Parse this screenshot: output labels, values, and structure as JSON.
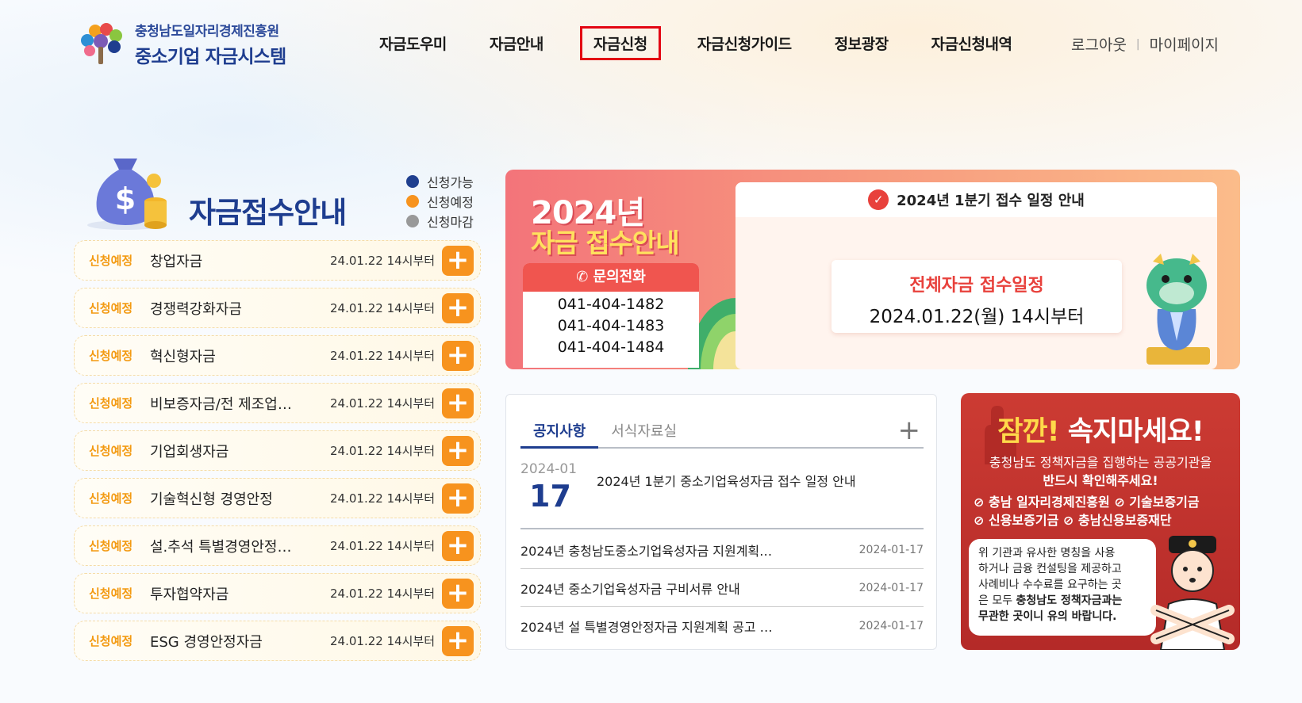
{
  "header": {
    "logo_sub": "충청남도일자리경제진흥원",
    "logo_main": "중소기업 자금시스템",
    "nav": [
      "자금도우미",
      "자금안내",
      "자금신청",
      "자금신청가이드",
      "정보광장",
      "자금신청내역"
    ],
    "active_nav": "자금신청",
    "logout": "로그아웃",
    "mypage": "마이페이지"
  },
  "fund_section": {
    "title": "자금접수안내",
    "legend": [
      {
        "label": "신청가능",
        "color": "#1f3f8f"
      },
      {
        "label": "신청예정",
        "color": "#f7931e"
      },
      {
        "label": "신청마감",
        "color": "#999999"
      }
    ],
    "items": [
      {
        "status": "신청예정",
        "name": "창업자금",
        "date": "24.01.22 14시부터"
      },
      {
        "status": "신청예정",
        "name": "경쟁력강화자금",
        "date": "24.01.22 14시부터"
      },
      {
        "status": "신청예정",
        "name": "혁신형자금",
        "date": "24.01.22 14시부터"
      },
      {
        "status": "신청예정",
        "name": "비보증자금/전 제조업…",
        "date": "24.01.22 14시부터"
      },
      {
        "status": "신청예정",
        "name": "기업회생자금",
        "date": "24.01.22 14시부터"
      },
      {
        "status": "신청예정",
        "name": "기술혁신형 경영안정",
        "date": "24.01.22 14시부터"
      },
      {
        "status": "신청예정",
        "name": "설.추석 특별경영안정…",
        "date": "24.01.22 14시부터"
      },
      {
        "status": "신청예정",
        "name": "투자협약자금",
        "date": "24.01.22 14시부터"
      },
      {
        "status": "신청예정",
        "name": "ESG 경영안정자금",
        "date": "24.01.22 14시부터"
      }
    ]
  },
  "banner": {
    "year": "2024년",
    "subtitle": "자금 접수안내",
    "contact_label": "문의전화",
    "phones": [
      "041-404-1482",
      "041-404-1483",
      "041-404-1484"
    ],
    "schedule_head": "2024년 1분기 접수 일정 안내",
    "schedule_title": "전체자금 접수일정",
    "schedule_date": "2024.01.22(월) 14시부터"
  },
  "notice": {
    "tabs": [
      "공지사항",
      "서식자료실"
    ],
    "top": {
      "ym": "2024-01",
      "day": "17",
      "title": "2024년 1분기 중소기업육성자금 접수 일정 안내"
    },
    "items": [
      {
        "title": "2024년 충청남도중소기업육성자금 지원계획…",
        "date": "2024-01-17"
      },
      {
        "title": "2024년 중소기업육성자금 구비서류 안내",
        "date": "2024-01-17"
      },
      {
        "title": "2024년 설 특별경영안정자금 지원계획 공고 …",
        "date": "2024-01-17"
      }
    ]
  },
  "warning": {
    "title_a": "잠깐!",
    "title_b": "속지마세요!",
    "sub1": "충청남도 정책자금을 집행하는 공공기관을",
    "sub2": "반드시 확인해주세요!",
    "orgs1": "⊘ 충남 일자리경제진흥원 ⊘ 기술보증기금",
    "orgs2": "⊘ 신용보증기금 ⊘ 충남신용보증재단",
    "text1": "위 기관과 유사한 명칭을 사용",
    "text2": "하거나 금융 컨설팅을 제공하고",
    "text3": "사례비나 수수료를 요구하는 곳",
    "text4a": "은 모두 ",
    "text4b": "충청남도 정책자금과는",
    "text5": "무관한 곳이니 유의 바랍니다."
  }
}
